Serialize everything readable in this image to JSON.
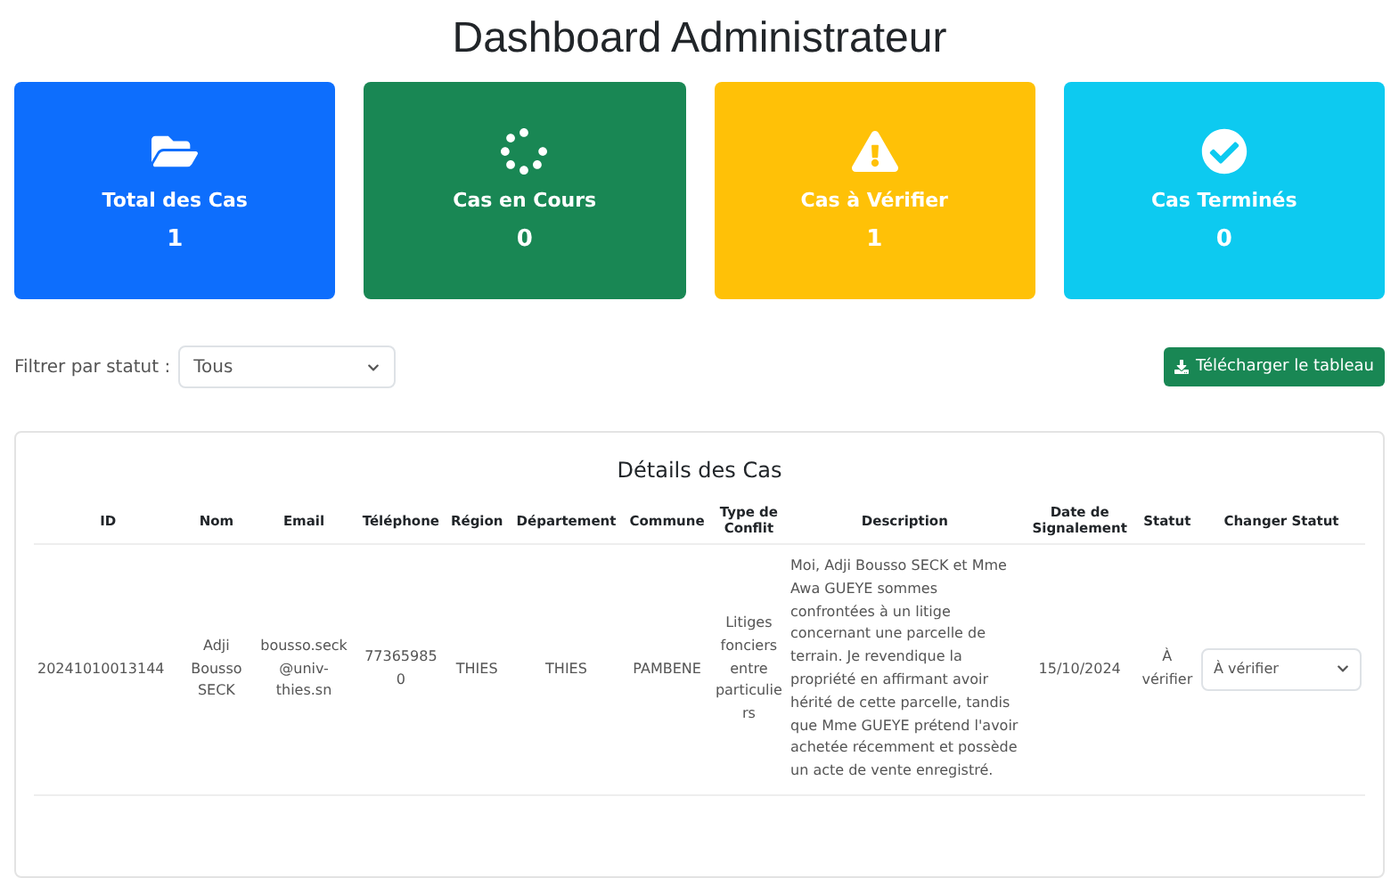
{
  "title": "Dashboard Administrateur",
  "stats": [
    {
      "kind": "total",
      "label": "Total des Cas",
      "value": "1",
      "color": "#0d6efd"
    },
    {
      "kind": "progress",
      "label": "Cas en Cours",
      "value": "0",
      "color": "#198754"
    },
    {
      "kind": "review",
      "label": "Cas à Vérifier",
      "value": "1",
      "color": "#ffc107"
    },
    {
      "kind": "done",
      "label": "Cas Terminés",
      "value": "0",
      "color": "#0dcaf0"
    }
  ],
  "filter": {
    "label": "Filtrer par statut :",
    "value": "Tous"
  },
  "download_button": "Télécharger le tableau",
  "table": {
    "title": "Détails des Cas",
    "columns": [
      "ID",
      "Nom",
      "Email",
      "Téléphone",
      "Région",
      "Département",
      "Commune",
      "Type de Conflit",
      "Description",
      "Date de Signalement",
      "Statut",
      "Changer Statut"
    ],
    "rows": [
      {
        "cells": [
          "20241010013144",
          "Adji Bousso SECK",
          "bousso.seck@univ-thies.sn",
          "773659850",
          "THIES",
          "THIES",
          "PAMBENE",
          "Litiges fonciers entre particuliers",
          "Moi, Adji Bousso SECK et Mme Awa GUEYE sommes confrontées à un litige concernant une parcelle de terrain. Je revendique la propriété en affirmant avoir hérité de cette parcelle, tandis que Mme GUEYE prétend l'avoir achetée récemment et possède un acte de vente enregistré.",
          "15/10/2024",
          "À vérifier"
        ],
        "status_select": "À vérifier"
      }
    ]
  }
}
